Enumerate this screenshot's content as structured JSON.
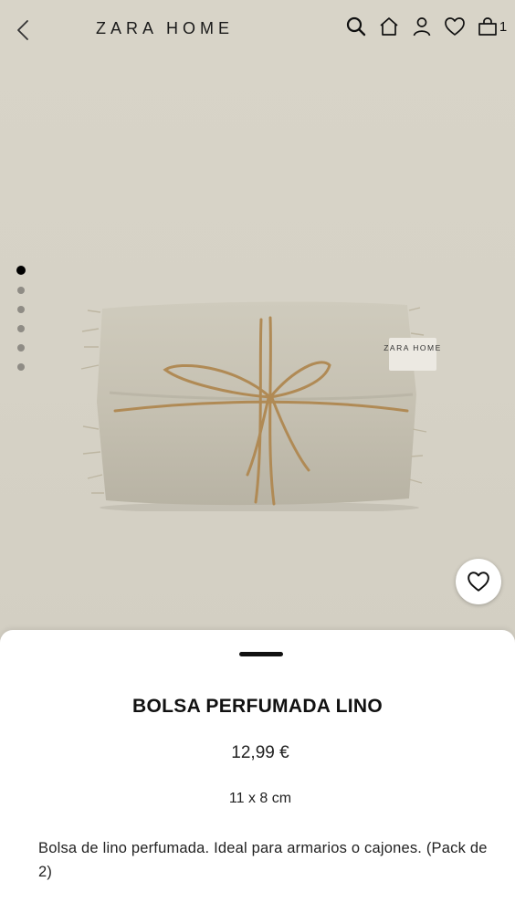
{
  "header": {
    "brand": "ZARA HOME",
    "cart_count": "1",
    "icons": [
      "back-arrow-icon",
      "search-icon",
      "home-icon",
      "user-icon",
      "heart-icon",
      "shopping-bag-icon"
    ]
  },
  "gallery": {
    "image_count": 6,
    "active_index": 0,
    "label_text": "ZARA HOME"
  },
  "product": {
    "name": "BOLSA PERFUMADA LINO",
    "price": "12,99 €",
    "size": "11 x 8 cm",
    "description": "Bolsa de lino perfumada. Ideal para armarios o cajones. (Pack de 2)"
  },
  "colors": {
    "background": "#d6d2c6",
    "sheet": "#ffffff",
    "text": "#111111"
  }
}
